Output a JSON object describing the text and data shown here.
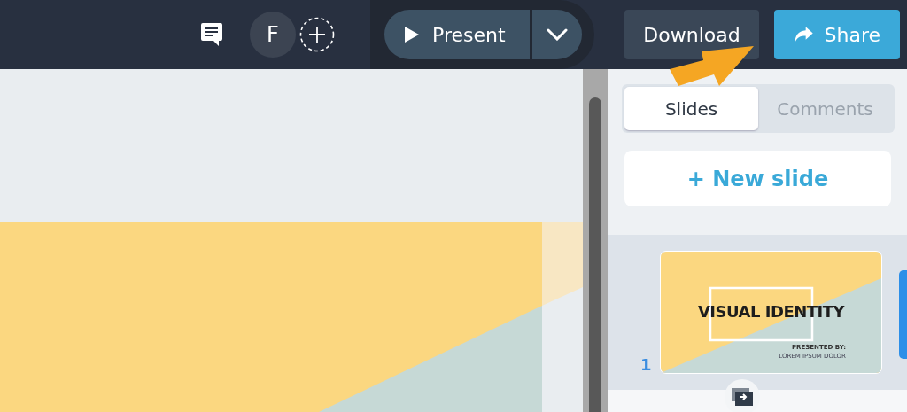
{
  "toolbar": {
    "avatar_initial": "F",
    "present_button": "Present",
    "download_button": "Download",
    "share_button": "Share"
  },
  "panel_tabs": [
    {
      "label": "Slides",
      "selected": true
    },
    {
      "label": "Comments",
      "selected": false
    }
  ],
  "new_slide_button": "+ New slide",
  "slides": [
    {
      "number": "1",
      "title": "VISUAL IDENTITY",
      "presented_by": "PRESENTED BY:",
      "author": "LOREM IPSUM DOLOR",
      "selected": true
    }
  ]
}
